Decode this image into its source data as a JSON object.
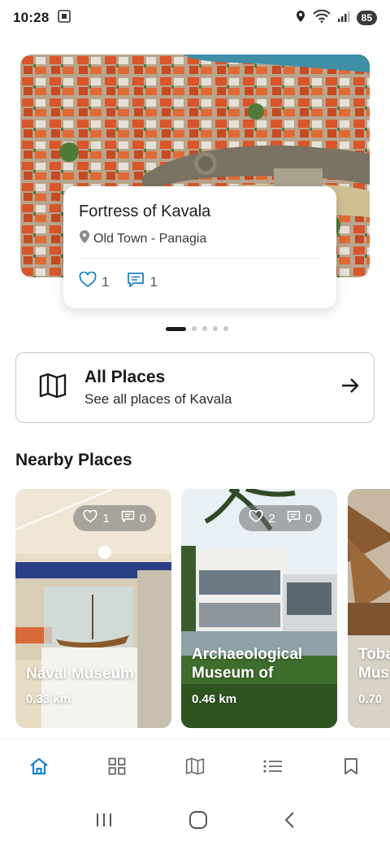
{
  "status_bar": {
    "time": "10:28",
    "battery": "85",
    "icons": [
      "screenshot-icon",
      "location-icon",
      "wifi-icon",
      "signal-icon"
    ]
  },
  "hero": {
    "title": "Fortress of Kavala",
    "location": "Old Town - Panagia",
    "likes": "1",
    "comments": "1",
    "carousel_pages": 5,
    "active_page": 1
  },
  "all_places": {
    "title": "All Places",
    "subtitle": "See all places of Kavala"
  },
  "nearby": {
    "section_title": "Nearby Places",
    "places": [
      {
        "name": "Naval Museum",
        "distance": "0.33 km",
        "likes": "1",
        "comments": "0"
      },
      {
        "name": "Archaeological Museum of",
        "distance": "0.46 km",
        "likes": "2",
        "comments": "0"
      },
      {
        "name": "Toba Mus",
        "distance": "0.70",
        "likes": "",
        "comments": ""
      }
    ]
  },
  "bottom_nav": [
    "home-icon",
    "grid-icon",
    "map-icon",
    "list-icon",
    "bookmark-icon"
  ],
  "colors": {
    "accent": "#1a84c7",
    "inactive": "#6b6b6b"
  }
}
